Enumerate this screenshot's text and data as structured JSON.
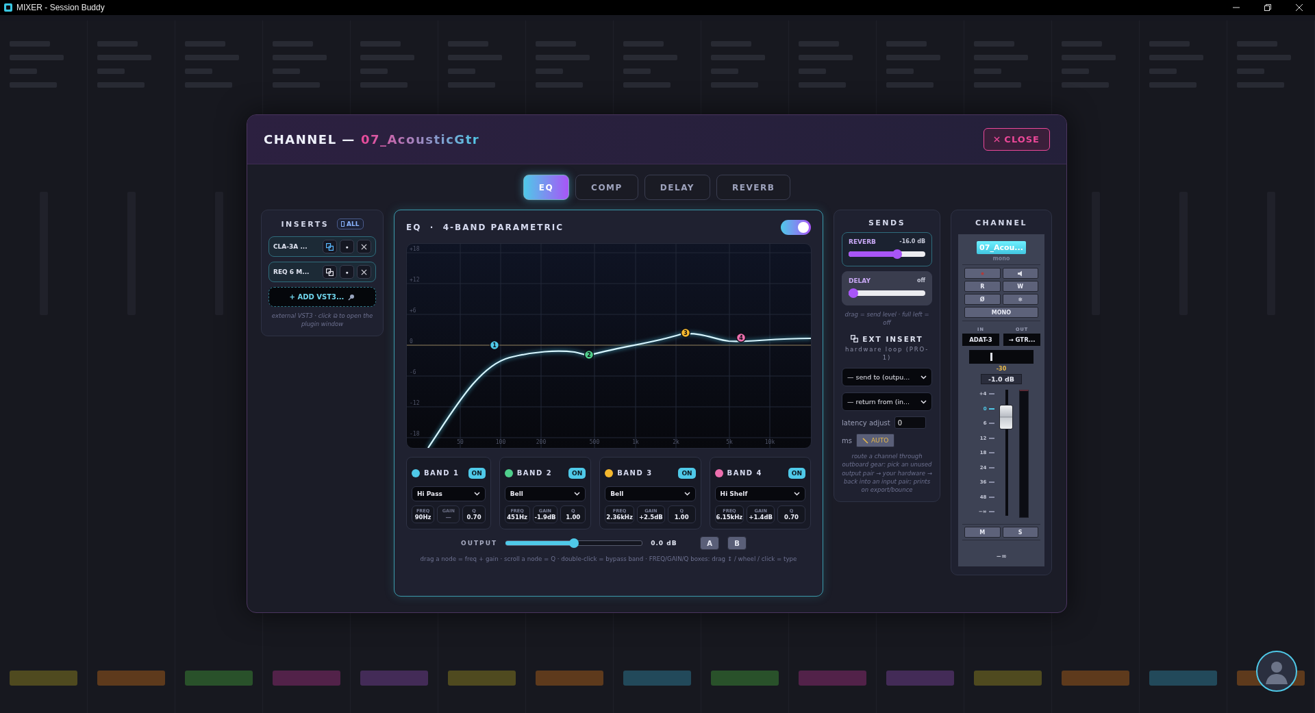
{
  "titlebar": {
    "title": "MIXER - Session Buddy"
  },
  "background_strips": [
    {
      "color": "#4f4a1f"
    },
    {
      "color": "#5e3a1c"
    },
    {
      "color": "#29512a"
    },
    {
      "color": "#522249"
    },
    {
      "color": "#432b57"
    },
    {
      "color": "#4f4a1f"
    },
    {
      "color": "#5e3a1c"
    },
    {
      "color": "#22495a"
    },
    {
      "color": "#29512a"
    },
    {
      "color": "#522249"
    },
    {
      "color": "#432b57"
    },
    {
      "color": "#4f4a1f"
    },
    {
      "color": "#5e3a1c"
    },
    {
      "color": "#22495a"
    },
    {
      "color": "#5e3a1c"
    }
  ],
  "modal": {
    "title": "CHANNEL —",
    "channel_name": "07_AcousticGtr",
    "close_label": "CLOSE"
  },
  "tabs": [
    {
      "label": "EQ",
      "selected": true
    },
    {
      "label": "COMP",
      "selected": false
    },
    {
      "label": "DELAY",
      "selected": false
    },
    {
      "label": "REVERB",
      "selected": false
    }
  ],
  "inserts": {
    "title": "INSERTS",
    "all_button": "ALL",
    "items": [
      {
        "name": "CLA-3A ...",
        "window_open": true,
        "dot": "●"
      },
      {
        "name": "REQ 6 M...",
        "window_open": false,
        "dot": "●"
      }
    ],
    "add_button": "+ ADD VST3...",
    "hint": "external VST3 · click ⧉ to open the plugin window"
  },
  "eq": {
    "title": "EQ  ·  4-BAND PARAMETRIC",
    "enabled": true,
    "y_labels": [
      "+18",
      "+12",
      "+6",
      "0",
      "-6",
      "-12",
      "-18"
    ],
    "x_labels": [
      "50",
      "100",
      "200",
      "500",
      "1k",
      "2k",
      "5k",
      "10k"
    ],
    "bands": [
      {
        "node": "1",
        "title": "BAND 1",
        "color": "#4fc9e8",
        "on": true,
        "on_label": "ON",
        "type": "Hi Pass",
        "params": [
          {
            "label": "FREQ",
            "value": "90Hz",
            "disabled": false
          },
          {
            "label": "GAIN",
            "value": "—",
            "disabled": true
          },
          {
            "label": "Q",
            "value": "0.70",
            "disabled": false
          }
        ]
      },
      {
        "node": "2",
        "title": "BAND 2",
        "color": "#4fcf8c",
        "on": true,
        "on_label": "ON",
        "type": "Bell",
        "params": [
          {
            "label": "FREQ",
            "value": "451Hz",
            "disabled": false
          },
          {
            "label": "GAIN",
            "value": "-1.9dB",
            "disabled": false
          },
          {
            "label": "Q",
            "value": "1.00",
            "disabled": false
          }
        ]
      },
      {
        "node": "3",
        "title": "BAND 3",
        "color": "#f5b82e",
        "on": true,
        "on_label": "ON",
        "type": "Bell",
        "params": [
          {
            "label": "FREQ",
            "value": "2.36kHz",
            "disabled": false
          },
          {
            "label": "GAIN",
            "value": "+2.5dB",
            "disabled": false
          },
          {
            "label": "Q",
            "value": "1.00",
            "disabled": false
          }
        ]
      },
      {
        "node": "4",
        "title": "BAND 4",
        "color": "#ec6fae",
        "on": true,
        "on_label": "ON",
        "type": "Hi Shelf",
        "params": [
          {
            "label": "FREQ",
            "value": "6.15kHz",
            "disabled": false
          },
          {
            "label": "GAIN",
            "value": "+1.4dB",
            "disabled": false
          },
          {
            "label": "Q",
            "value": "0.70",
            "disabled": false
          }
        ]
      }
    ],
    "output": {
      "label": "OUTPUT",
      "level": 0.5,
      "reading": "0.0 dB",
      "ab": [
        "A",
        "B"
      ]
    },
    "hint": "drag a node = freq + gain · scroll a node = Q · double-click = bypass band · FREQ/GAIN/Q boxes: drag ↕ / wheel / click = type"
  },
  "sends": {
    "title": "SENDS",
    "items": [
      {
        "name": "REVERB",
        "reading": "-16.0 dB",
        "level": 0.65,
        "on": true
      },
      {
        "name": "DELAY",
        "reading": "off",
        "level": 0,
        "on": false
      }
    ],
    "hint": "drag = send level · full left = off",
    "ext_title": "EXT INSERT",
    "ext_subtitle": "hardware loop (PRO-1)",
    "send_to": "— send to (outpu...",
    "return_from": "— return from (in...",
    "latency_label": "latency adjust",
    "latency_value": "0",
    "ms": "ms",
    "auto_button": "AUTO",
    "ext_hint": "route a channel through outboard gear: pick an unused output pair → your hardware → back into an input pair; prints on export/bounce"
  },
  "channel": {
    "title": "CHANNEL",
    "name": "07_Acou...",
    "mode": "mono",
    "buttons": [
      {
        "kind": "record"
      },
      {
        "kind": "speaker"
      },
      {
        "kind": "text",
        "label": "R"
      },
      {
        "kind": "text",
        "label": "W"
      },
      {
        "kind": "text",
        "label": "Ø"
      },
      {
        "kind": "text",
        "label": "❄"
      }
    ],
    "mono_label": "MONO",
    "in_label": "IN",
    "out_label": "OUT",
    "input": "ADAT-3",
    "output": "→ GTR...",
    "input_reading": "-30",
    "gain_reading": "-1.0 dB",
    "scale": [
      {
        "label": "+4",
        "current": false
      },
      {
        "label": "0",
        "current": true
      },
      {
        "label": "6",
        "current": false
      },
      {
        "label": "12",
        "current": false
      },
      {
        "label": "18",
        "current": false
      },
      {
        "label": "24",
        "current": false
      },
      {
        "label": "36",
        "current": false
      },
      {
        "label": "48",
        "current": false
      },
      {
        "label": "−∞",
        "current": false
      }
    ],
    "fader": {
      "level": 0.85
    },
    "mute": "M",
    "solo": "S",
    "peak": "−∞"
  }
}
